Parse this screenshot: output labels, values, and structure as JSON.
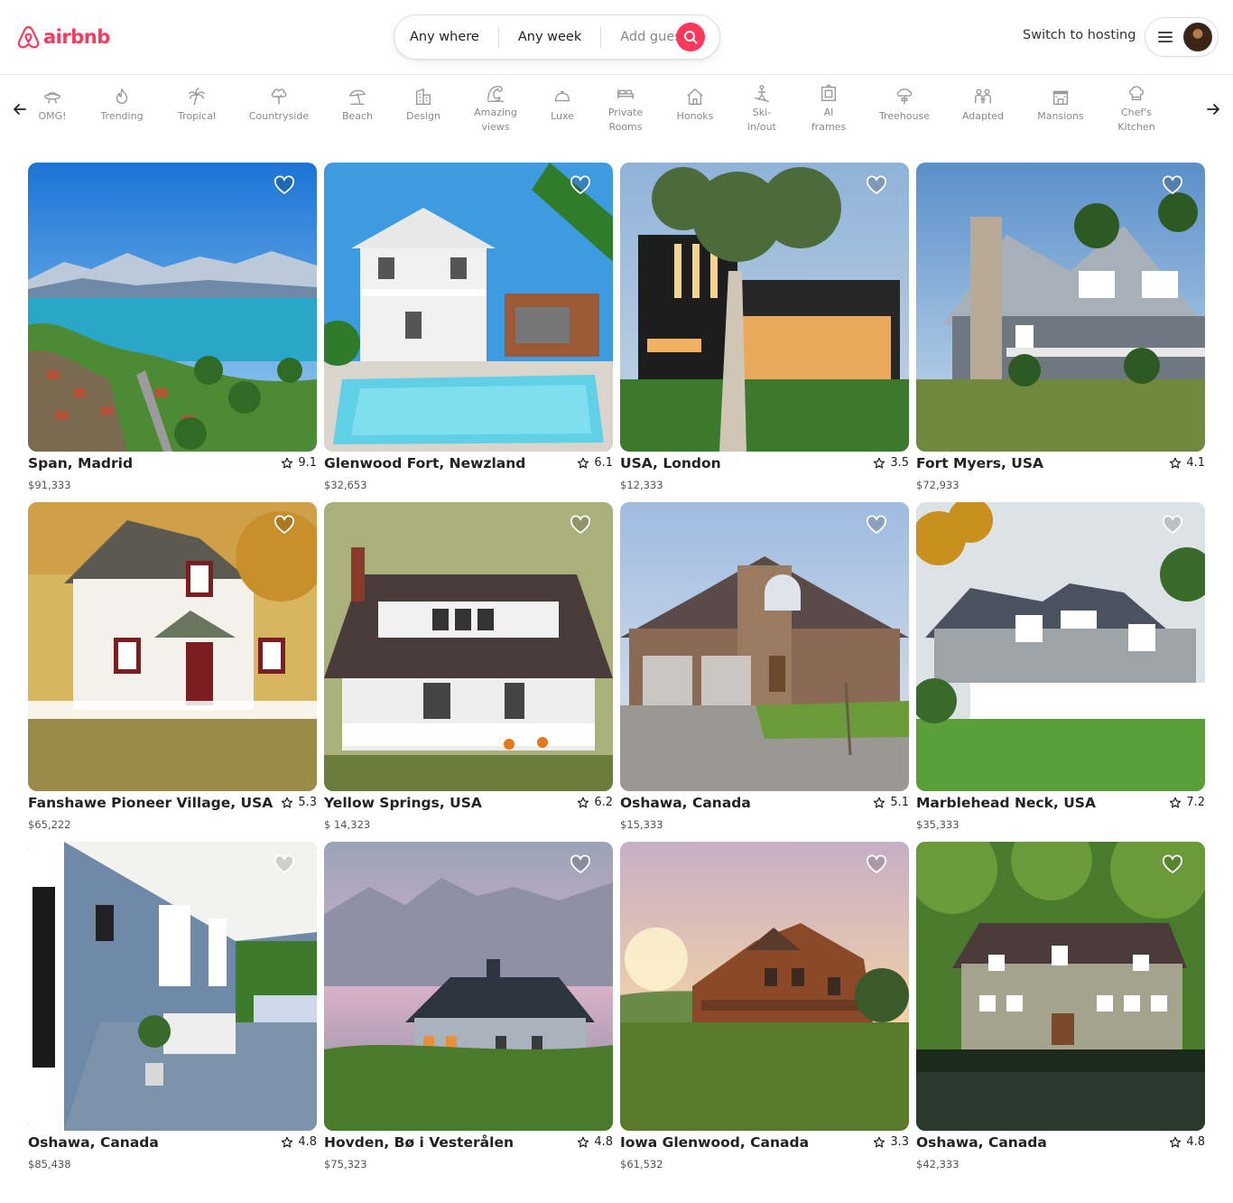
{
  "brand": {
    "name": "airbnb",
    "accent": "#ff385c"
  },
  "search": {
    "where": "Any where",
    "week": "Any week",
    "guest": "Add guest"
  },
  "header": {
    "switch_hosting": "Switch to hosting"
  },
  "categories": [
    {
      "label": "OMG!",
      "icon": "ufo-icon"
    },
    {
      "label": "Trending",
      "icon": "flame-icon"
    },
    {
      "label": "Tropical",
      "icon": "palm-tree-icon"
    },
    {
      "label": "Countryside",
      "icon": "tree-icon"
    },
    {
      "label": "Beach",
      "icon": "beach-umbrella-icon"
    },
    {
      "label": "Design",
      "icon": "building-icon"
    },
    {
      "label": "Amazing\nviews",
      "icon": "wave-icon"
    },
    {
      "label": "Luxe",
      "icon": "bell-icon"
    },
    {
      "label": "Private\nRooms",
      "icon": "bed-icon"
    },
    {
      "label": "Honoks",
      "icon": "house-icon"
    },
    {
      "label": "Ski-\nin/out",
      "icon": "ski-icon"
    },
    {
      "label": "AI\nframes",
      "icon": "frame-icon"
    },
    {
      "label": "Treehouse",
      "icon": "treehouse-icon"
    },
    {
      "label": "Adapted",
      "icon": "people-icon"
    },
    {
      "label": "Mansions",
      "icon": "mansion-icon"
    },
    {
      "label": "Chef's\nKitchen",
      "icon": "chef-hat-icon"
    }
  ],
  "listings": [
    {
      "title": "Span, Madrid",
      "rating": "9.1",
      "price": "$91,333"
    },
    {
      "title": "Glenwood Fort, Newzland",
      "rating": "6.1",
      "price": "$32,653"
    },
    {
      "title": "USA, London",
      "rating": "3.5",
      "price": "$12,333"
    },
    {
      "title": "Fort Myers, USA",
      "rating": "4.1",
      "price": "$72,933"
    },
    {
      "title": "Fanshawe Pioneer Village, USA",
      "rating": "5.3",
      "price": "$65,222"
    },
    {
      "title": "Yellow Springs, USA",
      "rating": "6.2",
      "price": "$ 14,323"
    },
    {
      "title": "Oshawa, Canada",
      "rating": "5.1",
      "price": "$15,333"
    },
    {
      "title": "Marblehead Neck, USA",
      "rating": "7.2",
      "price": "$35,333"
    },
    {
      "title": "Oshawa, Canada",
      "rating": "4.8",
      "price": "$85,438"
    },
    {
      "title": "Hovden, Bø i Vesterålen",
      "rating": "4.8",
      "price": "$75,323"
    },
    {
      "title": "Iowa Glenwood, Canada",
      "rating": "3.3",
      "price": "$61,532"
    },
    {
      "title": "Oshawa, Canada",
      "rating": "4.8",
      "price": "$42,333"
    }
  ]
}
